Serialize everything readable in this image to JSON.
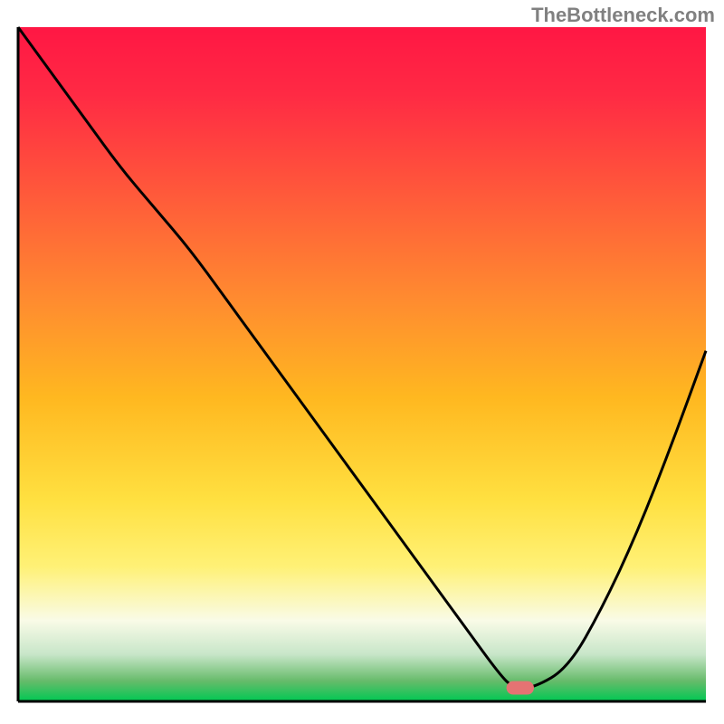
{
  "watermark": "TheBottleneck.com",
  "chart_data": {
    "type": "line",
    "title": "",
    "xlabel": "",
    "ylabel": "",
    "xlim": [
      0,
      100
    ],
    "ylim": [
      0,
      100
    ],
    "background_gradient": {
      "stops": [
        {
          "offset": 0,
          "color": "#ff1744"
        },
        {
          "offset": 10,
          "color": "#ff2a44"
        },
        {
          "offset": 25,
          "color": "#ff5a3a"
        },
        {
          "offset": 40,
          "color": "#ff8a30"
        },
        {
          "offset": 55,
          "color": "#ffb820"
        },
        {
          "offset": 70,
          "color": "#ffe040"
        },
        {
          "offset": 80,
          "color": "#fff176"
        },
        {
          "offset": 88,
          "color": "#f9fbe7"
        },
        {
          "offset": 93,
          "color": "#c8e6c9"
        },
        {
          "offset": 97,
          "color": "#66bb6a"
        },
        {
          "offset": 100,
          "color": "#00c853"
        }
      ]
    },
    "curve": {
      "x": [
        0,
        5,
        10,
        15,
        20,
        25,
        30,
        35,
        40,
        45,
        50,
        55,
        60,
        65,
        70,
        72,
        75,
        80,
        85,
        90,
        95,
        100
      ],
      "y": [
        100,
        93,
        86,
        79,
        73,
        67,
        60,
        53,
        46,
        39,
        32,
        25,
        18,
        11,
        4,
        2,
        2,
        5,
        14,
        25,
        38,
        52
      ]
    },
    "marker": {
      "x": 73,
      "y": 2,
      "color": "#e57373",
      "width": 4,
      "height": 2
    },
    "axes_color": "#000000"
  }
}
